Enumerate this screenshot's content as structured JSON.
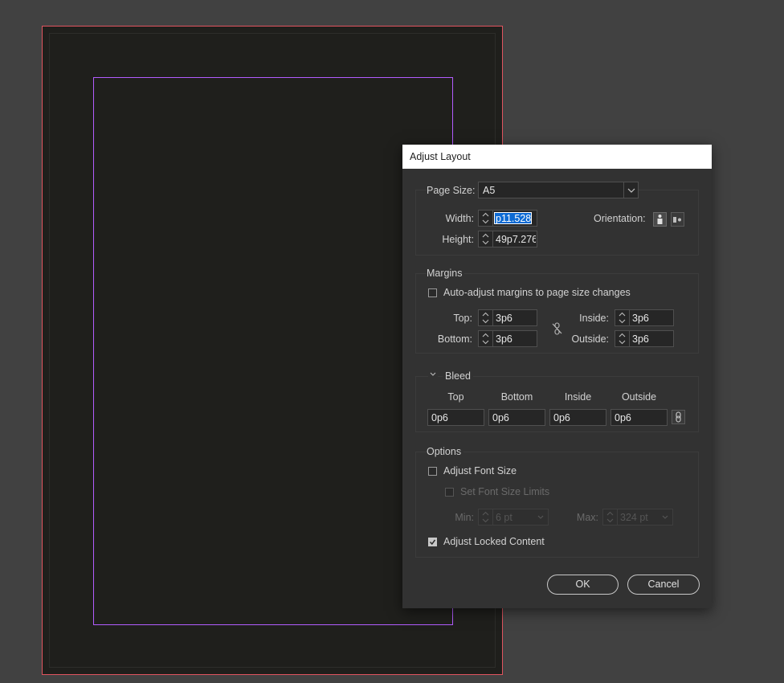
{
  "dialog": {
    "title": "Adjust Layout",
    "page_size_label": "Page Size:",
    "page_size_value": "A5",
    "width_label": "Width:",
    "width_value": "p11.528",
    "height_label": "Height:",
    "height_value": "49p7.276",
    "orientation_label": "Orientation:",
    "margins": {
      "title": "Margins",
      "auto_adjust_label": "Auto-adjust margins to page size changes",
      "auto_adjust_checked": false,
      "top_label": "Top:",
      "top_value": "3p6",
      "bottom_label": "Bottom:",
      "bottom_value": "3p6",
      "inside_label": "Inside:",
      "inside_value": "3p6",
      "outside_label": "Outside:",
      "outside_value": "3p6"
    },
    "bleed": {
      "title": "Bleed",
      "top_label": "Top",
      "top_value": "0p6",
      "bottom_label": "Bottom",
      "bottom_value": "0p6",
      "inside_label": "Inside",
      "inside_value": "0p6",
      "outside_label": "Outside",
      "outside_value": "0p6"
    },
    "options": {
      "title": "Options",
      "adjust_font_size_label": "Adjust Font Size",
      "adjust_font_size_checked": false,
      "set_font_limits_label": "Set Font Size Limits",
      "min_label": "Min:",
      "min_value": "6 pt",
      "max_label": "Max:",
      "max_value": "324 pt",
      "adjust_locked_label": "Adjust Locked Content",
      "adjust_locked_checked": true
    },
    "ok_label": "OK",
    "cancel_label": "Cancel"
  },
  "colors": {
    "bleed_guide": "#e0545f",
    "margin_guide": "#b35cff",
    "selection": "#0d6ad3"
  }
}
